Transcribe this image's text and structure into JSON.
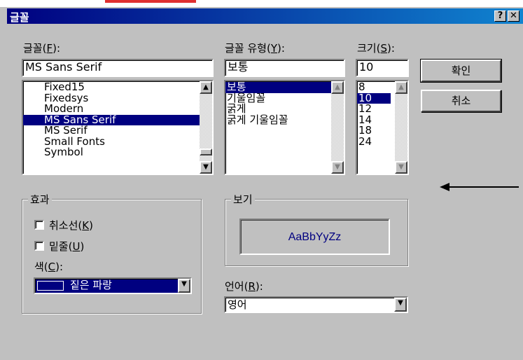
{
  "dialog": {
    "title": "글꼴",
    "help_button": "?",
    "close_button": "✕"
  },
  "font": {
    "label": "글꼴(",
    "mnemonic": "F",
    "label_end": "):",
    "value": "MS Sans Serif",
    "items": [
      "Fixed15",
      "Fixedsys",
      "Modern",
      "MS Sans Serif",
      "MS Serif",
      "Small Fonts",
      "Symbol"
    ],
    "selected": "MS Sans Serif"
  },
  "style": {
    "label": "글꼴 유형(",
    "mnemonic": "Y",
    "label_end": "):",
    "value": "보통",
    "items": [
      "보통",
      "기울임꼴",
      "굵게",
      "굵게 기울임꼴"
    ],
    "selected": "보통"
  },
  "size": {
    "label": "크기(",
    "mnemonic": "S",
    "label_end": "):",
    "value": "10",
    "items": [
      "8",
      "10",
      "12",
      "14",
      "18",
      "24"
    ],
    "selected": "10"
  },
  "buttons": {
    "ok": "확인",
    "cancel": "취소"
  },
  "effects": {
    "title": "효과",
    "strikeout": {
      "label": "취소선(",
      "mnemonic": "K",
      "label_end": ")",
      "checked": false
    },
    "underline": {
      "label": "밑줄(",
      "mnemonic": "U",
      "label_end": ")",
      "checked": false
    },
    "color_label": "색(",
    "color_mnemonic": "C",
    "color_label_end": "):",
    "color_value": "짙은 파랑",
    "color_swatch": "#000080"
  },
  "sample": {
    "title": "보기",
    "text": "AaBbYyZz",
    "text_color": "#000080"
  },
  "script": {
    "label": "언어(",
    "mnemonic": "R",
    "label_end": "):",
    "value": "영어"
  },
  "icons": {
    "scroll_up": "▲",
    "scroll_down": "▼",
    "dropdown": "▼"
  }
}
